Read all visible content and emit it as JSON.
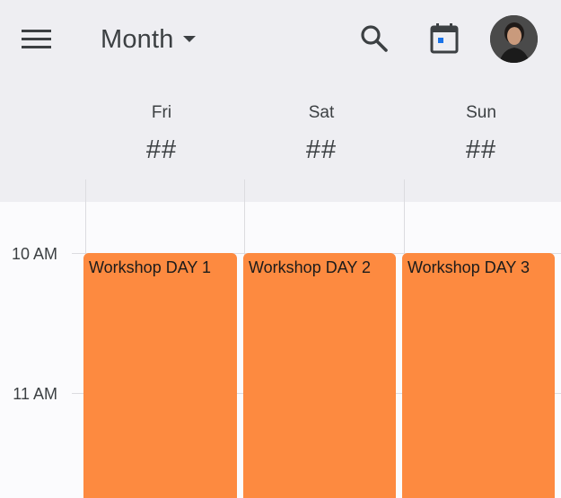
{
  "header": {
    "view_label": "Month",
    "icons": {
      "menu": "menu-icon",
      "view_dropdown": "caret-down-icon",
      "search": "search-icon",
      "today": "calendar-today-icon",
      "avatar": "user-avatar"
    }
  },
  "days": [
    {
      "name": "Fri",
      "number": "##"
    },
    {
      "name": "Sat",
      "number": "##"
    },
    {
      "name": "Sun",
      "number": "##"
    }
  ],
  "time_labels": [
    "10 AM",
    "11 AM"
  ],
  "events": [
    {
      "title": "Workshop DAY 1",
      "day": "Fri",
      "color": "#fd8a40"
    },
    {
      "title": "Workshop DAY 2",
      "day": "Sat",
      "color": "#fd8a40"
    },
    {
      "title": "Workshop DAY 3",
      "day": "Sun",
      "color": "#fd8a40"
    }
  ],
  "colors": {
    "header_bg": "#eeeef2",
    "body_bg": "#fbfbfd",
    "event": "#fd8a40",
    "text": "#3c4043",
    "today_icon_dot": "#1a73e8"
  }
}
